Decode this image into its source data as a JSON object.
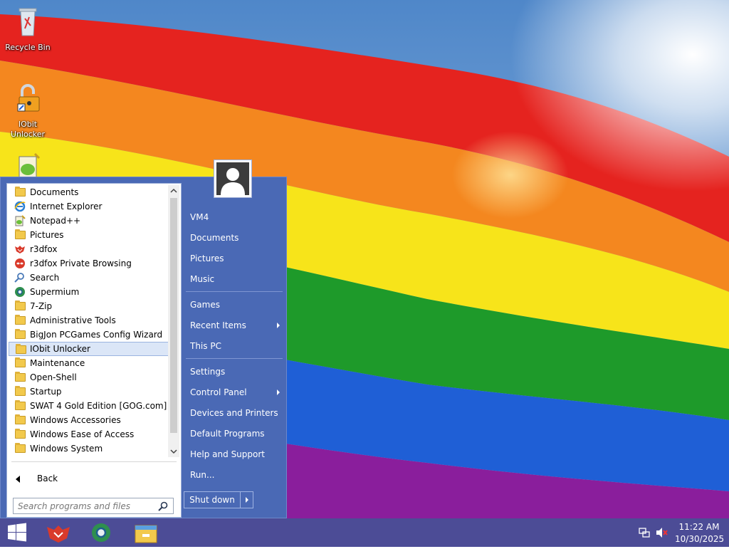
{
  "desktop": {
    "icons": [
      {
        "label": "Recycle Bin",
        "icon": "recycle-bin-icon"
      },
      {
        "label": "IObit Unlocker",
        "icon": "iobit-unlocker-icon"
      },
      {
        "label": "",
        "icon": "notepad-plus-plus-icon"
      }
    ]
  },
  "start_menu": {
    "programs": [
      {
        "label": "Documents",
        "icon": "folder-icon"
      },
      {
        "label": "Internet Explorer",
        "icon": "internet-explorer-icon"
      },
      {
        "label": "Notepad++",
        "icon": "notepad-plus-plus-icon"
      },
      {
        "label": "Pictures",
        "icon": "folder-icon"
      },
      {
        "label": "r3dfox",
        "icon": "r3dfox-icon"
      },
      {
        "label": "r3dfox Private Browsing",
        "icon": "r3dfox-private-icon"
      },
      {
        "label": "Search",
        "icon": "search-icon"
      },
      {
        "label": "Supermium",
        "icon": "supermium-icon"
      },
      {
        "label": "7-Zip",
        "icon": "folder-icon"
      },
      {
        "label": "Administrative Tools",
        "icon": "folder-icon"
      },
      {
        "label": "BigJon PCGames Config Wizard",
        "icon": "folder-icon"
      },
      {
        "label": "IObit Unlocker",
        "icon": "folder-icon",
        "selected": true
      },
      {
        "label": "Maintenance",
        "icon": "folder-icon"
      },
      {
        "label": "Open-Shell",
        "icon": "folder-icon"
      },
      {
        "label": "Startup",
        "icon": "folder-icon"
      },
      {
        "label": "SWAT 4 Gold Edition [GOG.com]",
        "icon": "folder-icon"
      },
      {
        "label": "Windows Accessories",
        "icon": "folder-icon"
      },
      {
        "label": "Windows Ease of Access",
        "icon": "folder-icon"
      },
      {
        "label": "Windows System",
        "icon": "folder-icon"
      }
    ],
    "back_label": "Back",
    "search_placeholder": "Search programs and files",
    "right_pane": {
      "items": [
        {
          "label": "VM4",
          "submenu": false
        },
        {
          "label": "Documents",
          "submenu": false
        },
        {
          "label": "Pictures",
          "submenu": false
        },
        {
          "label": "Music",
          "submenu": false
        },
        {
          "label": "Games",
          "submenu": false
        },
        {
          "label": "Recent Items",
          "submenu": true
        },
        {
          "label": "This PC",
          "submenu": false
        },
        {
          "label": "Settings",
          "submenu": false
        },
        {
          "label": "Control Panel",
          "submenu": true
        },
        {
          "label": "Devices and Printers",
          "submenu": false
        },
        {
          "label": "Default Programs",
          "submenu": false
        },
        {
          "label": "Help and Support",
          "submenu": false
        },
        {
          "label": "Run...",
          "submenu": false
        }
      ],
      "shutdown_label": "Shut down"
    }
  },
  "taskbar": {
    "pinned": [
      {
        "name": "r3dfox",
        "icon": "r3dfox-icon"
      },
      {
        "name": "Supermium",
        "icon": "supermium-icon"
      },
      {
        "name": "File Explorer",
        "icon": "file-explorer-icon"
      }
    ],
    "tray": {
      "network_icon": "network-icon",
      "volume_icon": "volume-muted-icon"
    },
    "clock": {
      "time": "11:22 AM",
      "date": "10/30/2025"
    }
  },
  "colors": {
    "start_menu_bg": "#4a69b5",
    "taskbar_bg": "#46509a",
    "selection_bg": "#dbe6f7"
  }
}
